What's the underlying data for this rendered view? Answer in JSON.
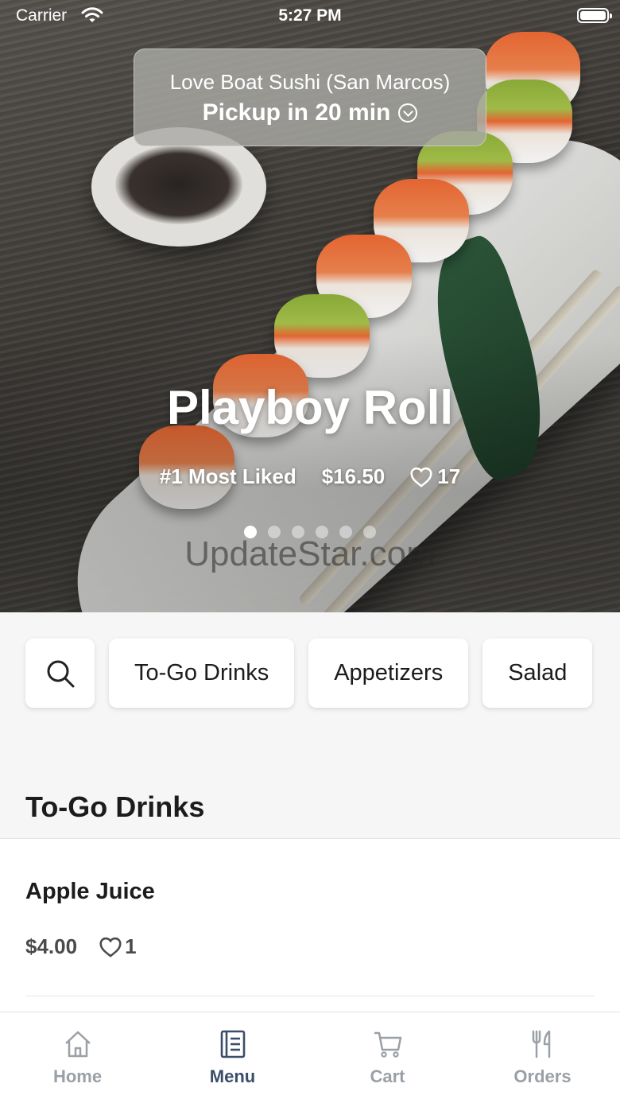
{
  "status_bar": {
    "carrier": "Carrier",
    "time": "5:27 PM"
  },
  "location": {
    "name": "Love Boat Sushi (San Marcos)",
    "pickup": "Pickup in 20 min"
  },
  "featured": {
    "title": "Playboy Roll",
    "badge": "#1 Most Liked",
    "price": "$16.50",
    "likes": "17",
    "page_count": 6,
    "active_page": 1
  },
  "watermark": "UpdateStar.com",
  "categories": [
    "To-Go Drinks",
    "Appetizers",
    "Salad"
  ],
  "section": {
    "title": "To-Go Drinks",
    "items": [
      {
        "name": "Apple Juice",
        "price": "$4.00",
        "likes": "1"
      }
    ]
  },
  "tabs": [
    {
      "label": "Home",
      "icon": "home-icon"
    },
    {
      "label": "Menu",
      "icon": "menu-icon"
    },
    {
      "label": "Cart",
      "icon": "cart-icon"
    },
    {
      "label": "Orders",
      "icon": "utensils-icon"
    }
  ],
  "active_tab": "Menu",
  "colors": {
    "active_tab": "#3a4e6b",
    "inactive_tab": "#9aa0a6"
  }
}
